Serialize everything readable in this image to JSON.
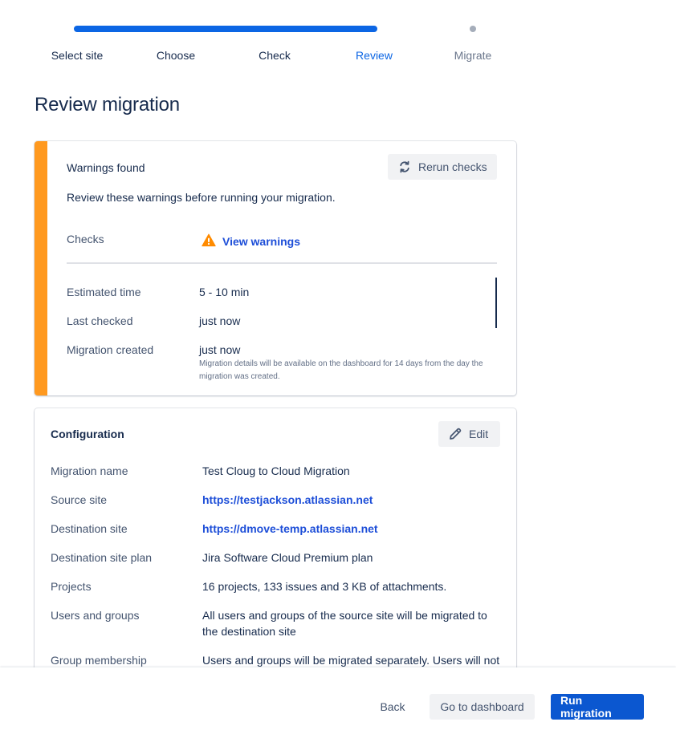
{
  "stepper": {
    "steps": [
      {
        "label": "Select site",
        "state": "done"
      },
      {
        "label": "Choose",
        "state": "done"
      },
      {
        "label": "Check",
        "state": "done"
      },
      {
        "label": "Review",
        "state": "current"
      },
      {
        "label": "Migrate",
        "state": "future"
      }
    ],
    "colors": {
      "done": "#0c66e4",
      "future": "#a5adba"
    }
  },
  "page": {
    "title": "Review migration"
  },
  "warnings": {
    "title": "Warnings found",
    "rerun_label": "Rerun checks",
    "description": "Review these warnings before running your migration.",
    "checks_label": "Checks",
    "view_warnings_label": "View warnings",
    "accent_color": "#ff991f",
    "rows": [
      {
        "label": "Estimated time",
        "value": "5 - 10 min"
      },
      {
        "label": "Last checked",
        "value": "just now"
      },
      {
        "label": "Migration created",
        "value": "just now"
      }
    ],
    "note": "Migration details will be available on the dashboard for 14 days from the day the migration was created."
  },
  "configuration": {
    "title": "Configuration",
    "edit_label": "Edit",
    "rows": [
      {
        "label": "Migration name",
        "value": "Test Cloug to Cloud Migration"
      },
      {
        "label": "Source site",
        "value": "https://testjackson.atlassian.net"
      },
      {
        "label": "Destination site",
        "value": "https://dmove-temp.atlassian.net"
      },
      {
        "label": "Destination site plan",
        "value": "Jira Software Cloud Premium plan"
      },
      {
        "label": "Projects",
        "value": "16 projects, 133 issues and 3 KB of attachments."
      },
      {
        "label": "Users and groups",
        "value": "All users and groups of the source site will be migrated to the destination site"
      },
      {
        "label": "Group membership",
        "value": "Users and groups will be migrated separately. Users will not"
      }
    ]
  },
  "footer": {
    "back_label": "Back",
    "dashboard_label": "Go to dashboard",
    "run_label": "Run migration",
    "primary_color": "#0b57d0"
  }
}
